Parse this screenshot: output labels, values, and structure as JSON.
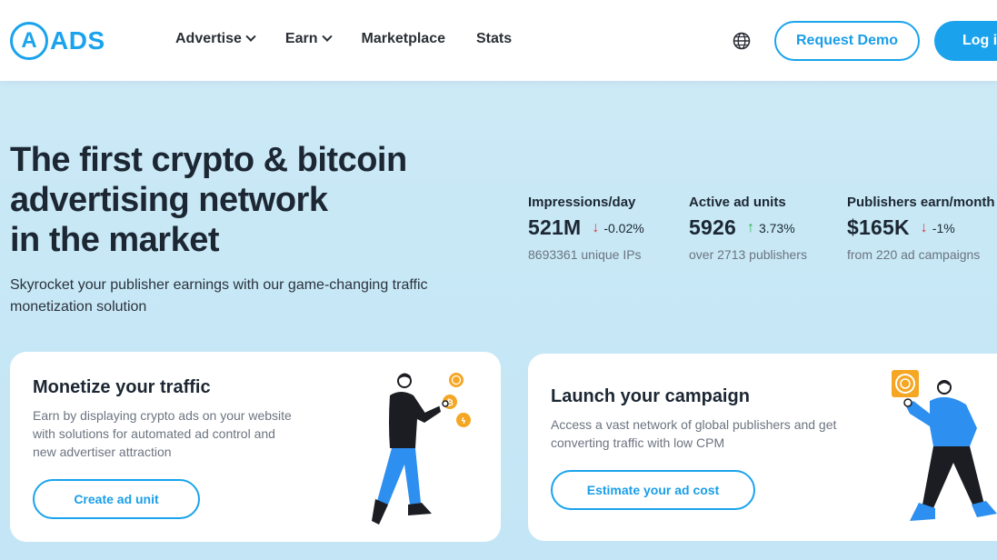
{
  "header": {
    "logo_letter": "A",
    "logo_text": "ADS",
    "nav": [
      {
        "label": "Advertise",
        "has_dropdown": true
      },
      {
        "label": "Earn",
        "has_dropdown": true
      },
      {
        "label": "Marketplace",
        "has_dropdown": false
      },
      {
        "label": "Stats",
        "has_dropdown": false
      }
    ],
    "language_icon": "globe-icon",
    "request_demo_label": "Request Demo",
    "login_label": "Log i"
  },
  "hero": {
    "title_line1": "The first crypto & bitcoin",
    "title_line2": "advertising network",
    "title_line3": "in the market",
    "subtitle_line1": "Skyrocket your publisher earnings with our game-changing traffic",
    "subtitle_line2": "monetization solution"
  },
  "stats": [
    {
      "label": "Impressions/day",
      "value": "521M",
      "direction": "down",
      "change": "-0.02%",
      "note": "8693361 unique IPs"
    },
    {
      "label": "Active ad units",
      "value": "5926",
      "direction": "up",
      "change": "3.73%",
      "note": "over 2713 publishers"
    },
    {
      "label": "Publishers earn/month",
      "value": "$165K",
      "direction": "down",
      "change": "-1%",
      "note": "from 220 ad campaigns"
    }
  ],
  "cards": [
    {
      "title": "Monetize your traffic",
      "desc_line1": "Earn by displaying crypto ads on your website",
      "desc_line2": "with solutions for automated ad control and",
      "desc_line3": "new advertiser attraction",
      "button_label": "Create ad unit"
    },
    {
      "title": "Launch your campaign",
      "desc_line1": "Access a vast network of global publishers and get",
      "desc_line2": "converting traffic with low CPM",
      "button_label": "Estimate your ad cost"
    }
  ],
  "colors": {
    "accent": "#1aa3ec",
    "down": "#e5393c",
    "up": "#2db34a",
    "coin": "#f5a623",
    "figure_blue": "#2d8ff0",
    "figure_dark": "#1b1d22"
  }
}
